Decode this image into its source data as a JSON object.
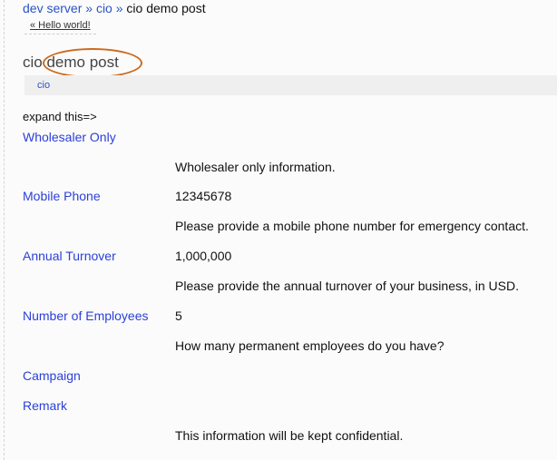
{
  "breadcrumb": {
    "items": [
      "dev server",
      "cio"
    ],
    "separator": "»",
    "current": "cio demo post"
  },
  "prev_link": "« Hello world!",
  "title": "cio demo post",
  "category": "cio",
  "expand_label": "expand this=>",
  "fields": {
    "wholesaler": {
      "label": "Wholesaler Only",
      "help": "Wholesaler only information."
    },
    "mobile": {
      "label": "Mobile Phone",
      "value": "12345678",
      "help": "Please provide a mobile phone number for emergency contact."
    },
    "turnover": {
      "label": "Annual Turnover",
      "value": "1,000,000",
      "help": "Please provide the annual turnover of your business, in USD."
    },
    "employees": {
      "label": "Number of Employees",
      "value": "5",
      "help": "How many permanent employees do you have?"
    },
    "campaign": {
      "label": "Campaign"
    },
    "remark": {
      "label": "Remark",
      "help": "This information will be kept confidential."
    }
  },
  "colors": {
    "link": "#2b52c6",
    "field_label": "#2b3fd8",
    "highlight": "#cc6a1e"
  }
}
